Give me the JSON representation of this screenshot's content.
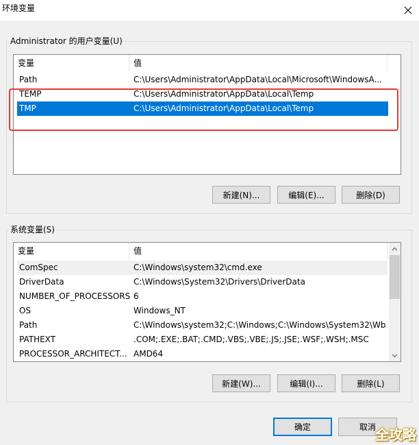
{
  "window": {
    "title": "环境变量",
    "close_icon": "close-icon"
  },
  "user_vars": {
    "group_label": "Administrator 的用户变量(U)",
    "columns": [
      "变量",
      "值"
    ],
    "rows": [
      {
        "name": "Path",
        "value": "C:\\Users\\Administrator\\AppData\\Local\\Microsoft\\WindowsA..."
      },
      {
        "name": "TEMP",
        "value": "C:\\Users\\Administrator\\AppData\\Local\\Temp"
      },
      {
        "name": "TMP",
        "value": "C:\\Users\\Administrator\\AppData\\Local\\Temp",
        "selected": true
      }
    ],
    "buttons": {
      "new": "新建(N)...",
      "edit": "编辑(E)...",
      "delete": "删除(D)"
    }
  },
  "system_vars": {
    "group_label": "系统变量(S)",
    "columns": [
      "变量",
      "值"
    ],
    "rows": [
      {
        "name": "ComSpec",
        "value": "C:\\Windows\\system32\\cmd.exe"
      },
      {
        "name": "DriverData",
        "value": "C:\\Windows\\System32\\Drivers\\DriverData"
      },
      {
        "name": "NUMBER_OF_PROCESSORS",
        "value": "6"
      },
      {
        "name": "OS",
        "value": "Windows_NT"
      },
      {
        "name": "Path",
        "value": "C:\\Windows\\system32;C:\\Windows;C:\\Windows\\System32\\Wb..."
      },
      {
        "name": "PATHEXT",
        "value": ".COM;.EXE;.BAT;.CMD;.VBS;.VBE;.JS;.JSE;.WSF;.WSH;.MSC"
      },
      {
        "name": "PROCESSOR_ARCHITECT...",
        "value": "AMD64"
      }
    ],
    "buttons": {
      "new": "新建(W)...",
      "edit": "编辑(I)...",
      "delete": "删除(L)"
    }
  },
  "footer": {
    "ok": "确定",
    "cancel": "取消"
  },
  "watermark": "全攻略",
  "colors": {
    "selection": "#0078d7",
    "highlight_box": "#e53935",
    "default_button_border": "#0078d7"
  }
}
